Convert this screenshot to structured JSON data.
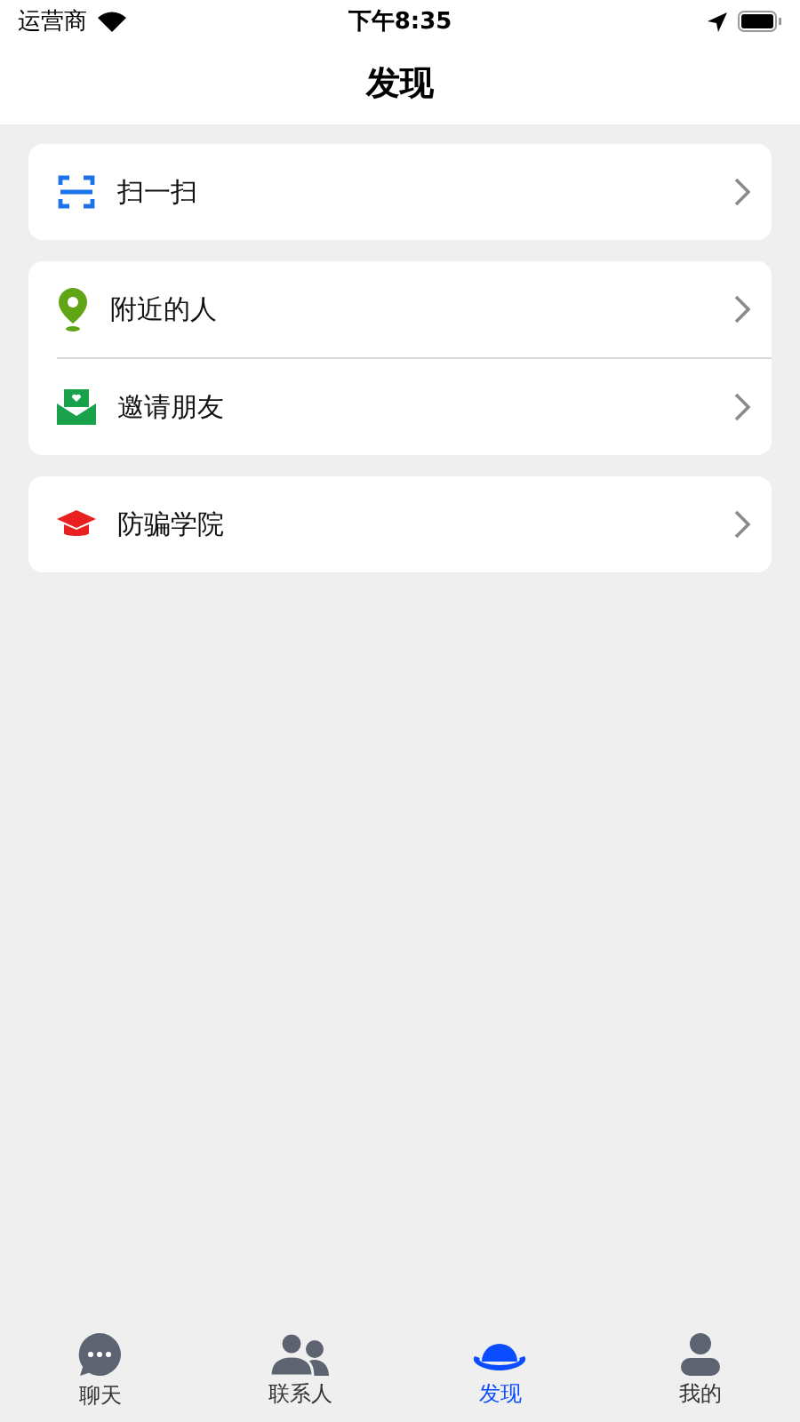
{
  "status_bar": {
    "carrier": "运营商",
    "time": "下午8:35"
  },
  "nav": {
    "title": "发现"
  },
  "groups": [
    {
      "items": [
        {
          "kind": "scan",
          "label": "扫一扫"
        }
      ]
    },
    {
      "items": [
        {
          "kind": "location",
          "label": "附近的人"
        },
        {
          "kind": "invite",
          "label": "邀请朋友"
        }
      ]
    },
    {
      "items": [
        {
          "kind": "academy",
          "label": "防骗学院"
        }
      ]
    }
  ],
  "tabs": [
    {
      "kind": "chat",
      "label": "聊天",
      "selected": false
    },
    {
      "kind": "contacts",
      "label": "联系人",
      "selected": false
    },
    {
      "kind": "discover",
      "label": "发现",
      "selected": true
    },
    {
      "kind": "me",
      "label": "我的",
      "selected": false
    }
  ]
}
